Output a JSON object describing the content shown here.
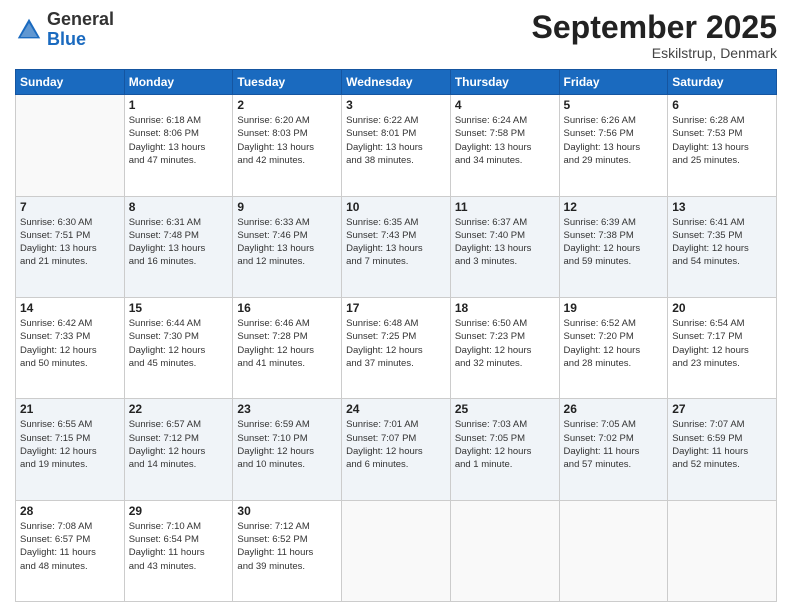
{
  "logo": {
    "general": "General",
    "blue": "Blue"
  },
  "header": {
    "month": "September 2025",
    "location": "Eskilstrup, Denmark"
  },
  "days": [
    "Sunday",
    "Monday",
    "Tuesday",
    "Wednesday",
    "Thursday",
    "Friday",
    "Saturday"
  ],
  "weeks": [
    [
      {
        "day": "",
        "info": ""
      },
      {
        "day": "1",
        "info": "Sunrise: 6:18 AM\nSunset: 8:06 PM\nDaylight: 13 hours\nand 47 minutes."
      },
      {
        "day": "2",
        "info": "Sunrise: 6:20 AM\nSunset: 8:03 PM\nDaylight: 13 hours\nand 42 minutes."
      },
      {
        "day": "3",
        "info": "Sunrise: 6:22 AM\nSunset: 8:01 PM\nDaylight: 13 hours\nand 38 minutes."
      },
      {
        "day": "4",
        "info": "Sunrise: 6:24 AM\nSunset: 7:58 PM\nDaylight: 13 hours\nand 34 minutes."
      },
      {
        "day": "5",
        "info": "Sunrise: 6:26 AM\nSunset: 7:56 PM\nDaylight: 13 hours\nand 29 minutes."
      },
      {
        "day": "6",
        "info": "Sunrise: 6:28 AM\nSunset: 7:53 PM\nDaylight: 13 hours\nand 25 minutes."
      }
    ],
    [
      {
        "day": "7",
        "info": "Sunrise: 6:30 AM\nSunset: 7:51 PM\nDaylight: 13 hours\nand 21 minutes."
      },
      {
        "day": "8",
        "info": "Sunrise: 6:31 AM\nSunset: 7:48 PM\nDaylight: 13 hours\nand 16 minutes."
      },
      {
        "day": "9",
        "info": "Sunrise: 6:33 AM\nSunset: 7:46 PM\nDaylight: 13 hours\nand 12 minutes."
      },
      {
        "day": "10",
        "info": "Sunrise: 6:35 AM\nSunset: 7:43 PM\nDaylight: 13 hours\nand 7 minutes."
      },
      {
        "day": "11",
        "info": "Sunrise: 6:37 AM\nSunset: 7:40 PM\nDaylight: 13 hours\nand 3 minutes."
      },
      {
        "day": "12",
        "info": "Sunrise: 6:39 AM\nSunset: 7:38 PM\nDaylight: 12 hours\nand 59 minutes."
      },
      {
        "day": "13",
        "info": "Sunrise: 6:41 AM\nSunset: 7:35 PM\nDaylight: 12 hours\nand 54 minutes."
      }
    ],
    [
      {
        "day": "14",
        "info": "Sunrise: 6:42 AM\nSunset: 7:33 PM\nDaylight: 12 hours\nand 50 minutes."
      },
      {
        "day": "15",
        "info": "Sunrise: 6:44 AM\nSunset: 7:30 PM\nDaylight: 12 hours\nand 45 minutes."
      },
      {
        "day": "16",
        "info": "Sunrise: 6:46 AM\nSunset: 7:28 PM\nDaylight: 12 hours\nand 41 minutes."
      },
      {
        "day": "17",
        "info": "Sunrise: 6:48 AM\nSunset: 7:25 PM\nDaylight: 12 hours\nand 37 minutes."
      },
      {
        "day": "18",
        "info": "Sunrise: 6:50 AM\nSunset: 7:23 PM\nDaylight: 12 hours\nand 32 minutes."
      },
      {
        "day": "19",
        "info": "Sunrise: 6:52 AM\nSunset: 7:20 PM\nDaylight: 12 hours\nand 28 minutes."
      },
      {
        "day": "20",
        "info": "Sunrise: 6:54 AM\nSunset: 7:17 PM\nDaylight: 12 hours\nand 23 minutes."
      }
    ],
    [
      {
        "day": "21",
        "info": "Sunrise: 6:55 AM\nSunset: 7:15 PM\nDaylight: 12 hours\nand 19 minutes."
      },
      {
        "day": "22",
        "info": "Sunrise: 6:57 AM\nSunset: 7:12 PM\nDaylight: 12 hours\nand 14 minutes."
      },
      {
        "day": "23",
        "info": "Sunrise: 6:59 AM\nSunset: 7:10 PM\nDaylight: 12 hours\nand 10 minutes."
      },
      {
        "day": "24",
        "info": "Sunrise: 7:01 AM\nSunset: 7:07 PM\nDaylight: 12 hours\nand 6 minutes."
      },
      {
        "day": "25",
        "info": "Sunrise: 7:03 AM\nSunset: 7:05 PM\nDaylight: 12 hours\nand 1 minute."
      },
      {
        "day": "26",
        "info": "Sunrise: 7:05 AM\nSunset: 7:02 PM\nDaylight: 11 hours\nand 57 minutes."
      },
      {
        "day": "27",
        "info": "Sunrise: 7:07 AM\nSunset: 6:59 PM\nDaylight: 11 hours\nand 52 minutes."
      }
    ],
    [
      {
        "day": "28",
        "info": "Sunrise: 7:08 AM\nSunset: 6:57 PM\nDaylight: 11 hours\nand 48 minutes."
      },
      {
        "day": "29",
        "info": "Sunrise: 7:10 AM\nSunset: 6:54 PM\nDaylight: 11 hours\nand 43 minutes."
      },
      {
        "day": "30",
        "info": "Sunrise: 7:12 AM\nSunset: 6:52 PM\nDaylight: 11 hours\nand 39 minutes."
      },
      {
        "day": "",
        "info": ""
      },
      {
        "day": "",
        "info": ""
      },
      {
        "day": "",
        "info": ""
      },
      {
        "day": "",
        "info": ""
      }
    ]
  ]
}
